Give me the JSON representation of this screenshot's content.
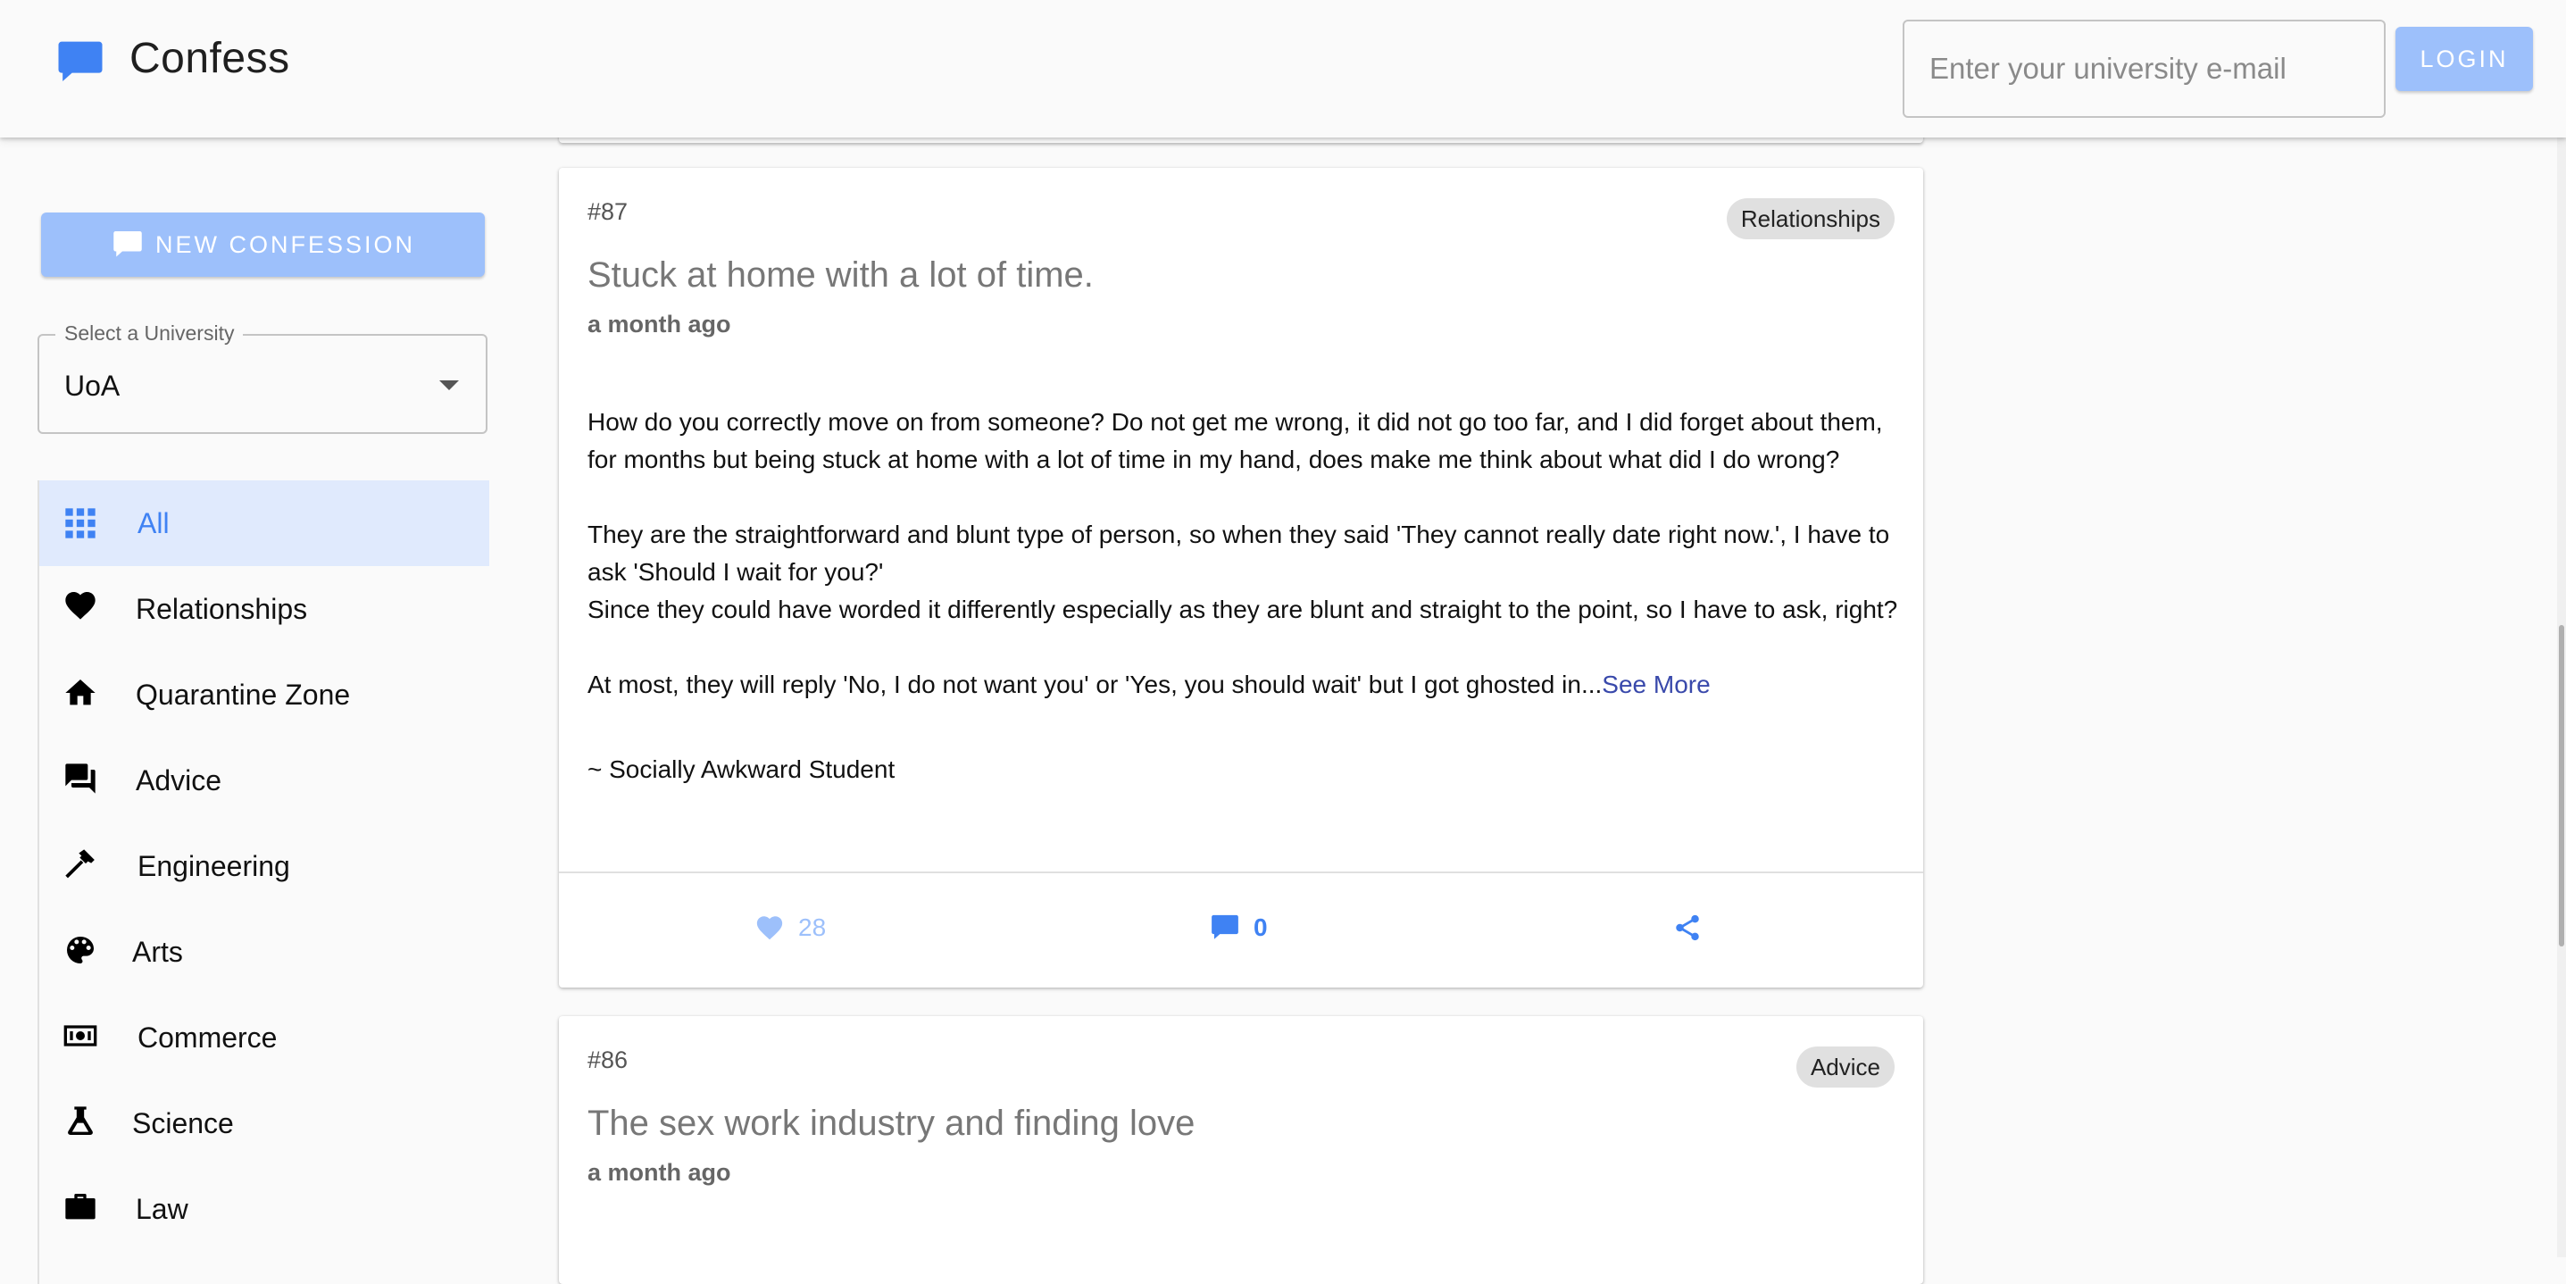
{
  "colors": {
    "accent": "#3f82f3",
    "accent_light": "#9dc0fb",
    "active_bg": "#e0eafd",
    "link": "#3949ab"
  },
  "header": {
    "app_title": "Confess",
    "logo_icon": "chat-bubble-icon",
    "email_placeholder": "Enter your university e-mail",
    "login_label": "LOGIN"
  },
  "sidebar": {
    "new_confession_label": "NEW CONFESSION",
    "university_select": {
      "label": "Select a University",
      "value": "UoA"
    },
    "categories": [
      {
        "label": "All",
        "icon": "grid-icon",
        "active": true
      },
      {
        "label": "Relationships",
        "icon": "heart-icon",
        "active": false
      },
      {
        "label": "Quarantine Zone",
        "icon": "home-icon",
        "active": false
      },
      {
        "label": "Advice",
        "icon": "forum-icon",
        "active": false
      },
      {
        "label": "Engineering",
        "icon": "hammer-icon",
        "active": false
      },
      {
        "label": "Arts",
        "icon": "palette-icon",
        "active": false
      },
      {
        "label": "Commerce",
        "icon": "money-icon",
        "active": false
      },
      {
        "label": "Science",
        "icon": "flask-icon",
        "active": false
      },
      {
        "label": "Law",
        "icon": "briefcase-icon",
        "active": false
      }
    ]
  },
  "posts": [
    {
      "number": "#87",
      "tag": "Relationships",
      "title": "Stuck at home with a lot of time.",
      "time": "a month ago",
      "paragraphs": [
        "How do you correctly move on from someone? Do not get me wrong, it did not go too far, and I did forget about them, for months but being stuck at home with a lot of time in my hand, does make me think about what did I do wrong?",
        "They are the straightforward and blunt type of person, so when they said 'They cannot really date right now.', I have to ask 'Should I wait for you?'\nSince they could have worded it differently especially as they are blunt and straight to the point, so I have to ask, right?",
        "At most, they will reply 'No, I do not want you' or 'Yes, you should wait' but I got ghosted in..."
      ],
      "see_more": "See More",
      "signature": "~ Socially Awkward Student",
      "likes": "28",
      "comments": "0"
    },
    {
      "number": "#86",
      "tag": "Advice",
      "title": "The sex work industry and finding love",
      "time": "a month ago"
    }
  ]
}
